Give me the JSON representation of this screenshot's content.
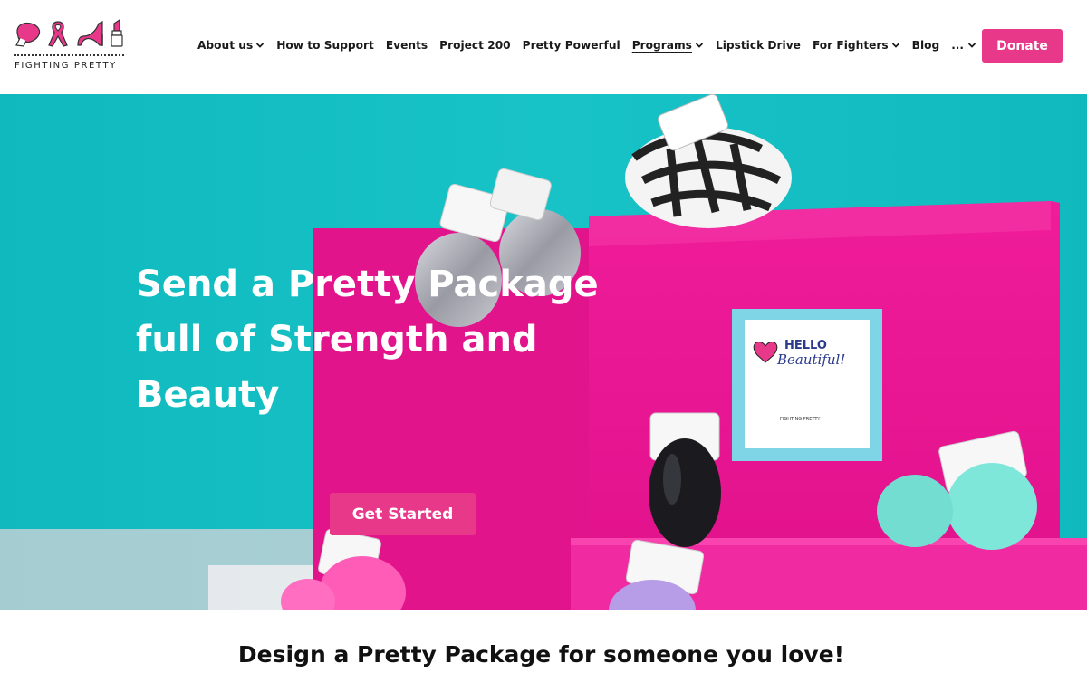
{
  "brand": {
    "name": "FIGHTING PRETTY",
    "colors": {
      "pink": "#e8388a",
      "teal": "#12bfc2",
      "magenta": "#ec1f8c"
    },
    "logo_icons": [
      "boxing-glove-icon",
      "ribbon-icon",
      "high-heel-icon",
      "lipstick-icon"
    ]
  },
  "nav": {
    "items": [
      {
        "label": "About us",
        "has_dropdown": true
      },
      {
        "label": "How to Support",
        "has_dropdown": false
      },
      {
        "label": "Events",
        "has_dropdown": false
      },
      {
        "label": "Project 200",
        "has_dropdown": false
      },
      {
        "label": "Pretty Powerful",
        "has_dropdown": false
      },
      {
        "label": "Programs",
        "has_dropdown": true,
        "active": true
      },
      {
        "label": "Lipstick Drive",
        "has_dropdown": false
      },
      {
        "label": "For Fighters",
        "has_dropdown": true
      },
      {
        "label": "Blog",
        "has_dropdown": false
      }
    ],
    "more_label": "...",
    "search_icon": "search-icon",
    "donate_label": "Donate"
  },
  "hero": {
    "title_lines": [
      "Send a Pretty Package",
      "full of Strength and",
      "Beauty"
    ],
    "cta_label": "Get Started",
    "card_text": {
      "hello": "HELLO",
      "beautiful": "Beautiful!",
      "brand": "FIGHTING PRETTY"
    }
  },
  "section": {
    "heading": "Design a Pretty Package for someone you love!"
  }
}
